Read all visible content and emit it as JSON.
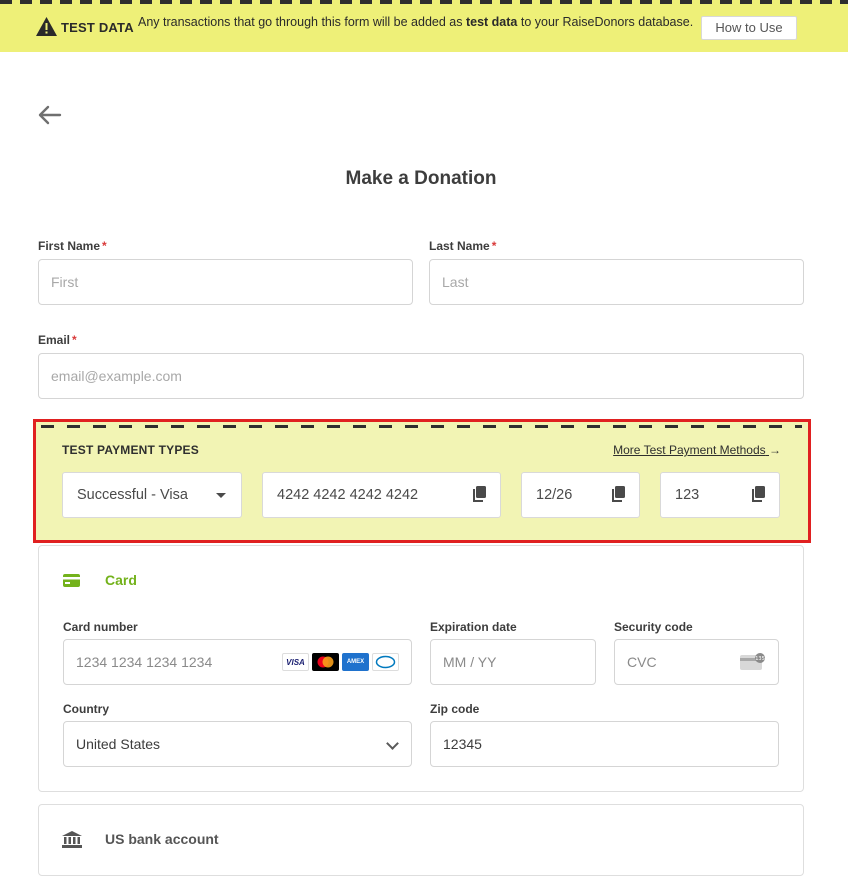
{
  "banner": {
    "label": "TEST DATA",
    "message_pre": "Any transactions that go through this form will be added as ",
    "message_bold": "test data",
    "message_post": " to your RaiseDonors database.",
    "how_button": "How to Use"
  },
  "page": {
    "title": "Make a Donation"
  },
  "form": {
    "first_name": {
      "label": "First Name",
      "required": "*",
      "placeholder": "First"
    },
    "last_name": {
      "label": "Last Name",
      "required": "*",
      "placeholder": "Last"
    },
    "email": {
      "label": "Email",
      "required": "*",
      "placeholder": "email@example.com"
    }
  },
  "test_payment": {
    "title": "TEST PAYMENT TYPES",
    "more_link": "More Test Payment Methods",
    "type_selected": "Successful - Visa",
    "card_number": "4242 4242 4242 4242",
    "expiry": "12/26",
    "cvc": "123"
  },
  "card_panel": {
    "tab_label": "Card",
    "card_number_label": "Card number",
    "card_number_placeholder": "1234 1234 1234 1234",
    "expiration_label": "Expiration date",
    "expiration_placeholder": "MM / YY",
    "security_label": "Security code",
    "security_placeholder": "CVC",
    "country_label": "Country",
    "country_value": "United States",
    "zip_label": "Zip code",
    "zip_value": "12345",
    "brands": [
      "visa-icon",
      "mastercard-icon",
      "amex-icon",
      "diners-icon"
    ]
  },
  "bank_panel": {
    "label": "US bank account"
  },
  "colors": {
    "banner_bg": "#eef078",
    "test_box_bg": "#f2f4b4",
    "test_box_border": "#e02020",
    "accent_green": "#73b21b"
  }
}
